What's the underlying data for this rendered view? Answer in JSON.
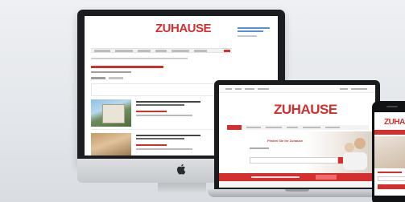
{
  "brand": {
    "zu": "ZU",
    "hause": "HAUSE"
  },
  "laptop": {
    "hero_title": "Finden Sie Ihr Zuhause"
  },
  "colors": {
    "accent": "#d32f2f",
    "link": "#5b8fd6",
    "highlight": "#f0a233"
  },
  "icons": {
    "apple": "apple-icon"
  }
}
